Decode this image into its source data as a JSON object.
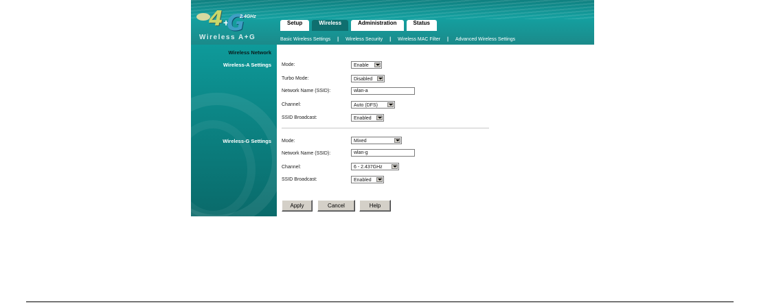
{
  "logo": {
    "four": "4",
    "g": "G",
    "plus": "+",
    "ghz": "2.4GHz",
    "wordmark": "Wireless A+G"
  },
  "tabs": [
    {
      "label": "Setup",
      "active": false
    },
    {
      "label": "Wireless",
      "active": true
    },
    {
      "label": "Administration",
      "active": false
    },
    {
      "label": "Status",
      "active": false
    }
  ],
  "subnav": [
    "Basic Wireless Settings",
    "Wireless Security",
    "Wireless MAC Filter",
    "Advanced Wireless Settings"
  ],
  "subnav_separator": "|",
  "sections": {
    "network_title": "Wireless Network",
    "wireless_a_title": "Wireless-A Settings",
    "wireless_g_title": "Wireless-G Settings"
  },
  "wireless_a": {
    "mode": {
      "label": "Mode:",
      "value": "Enable"
    },
    "turbo": {
      "label": "Turbo Mode:",
      "value": "Disabled"
    },
    "ssid": {
      "label": "Network Name (SSID):",
      "value": "wlan-a"
    },
    "channel": {
      "label": "Channel:",
      "value": "Auto (DFS)"
    },
    "broadcast": {
      "label": "SSID Broadcast:",
      "value": "Enabled"
    }
  },
  "wireless_g": {
    "mode": {
      "label": "Mode:",
      "value": "Mixed"
    },
    "ssid": {
      "label": "Network Name (SSID):",
      "value": "wlan-g"
    },
    "channel": {
      "label": "Channel:",
      "value": "6 - 2.437GHz"
    },
    "broadcast": {
      "label": "SSID Broadcast:",
      "value": "Enabled"
    }
  },
  "buttons": {
    "apply": "Apply",
    "cancel": "Cancel",
    "help": "Help"
  },
  "colors": {
    "header_teal": "#14a0a0",
    "active_tab": "#0f6f6f",
    "sidebar_teal": "#0c8a8a"
  }
}
